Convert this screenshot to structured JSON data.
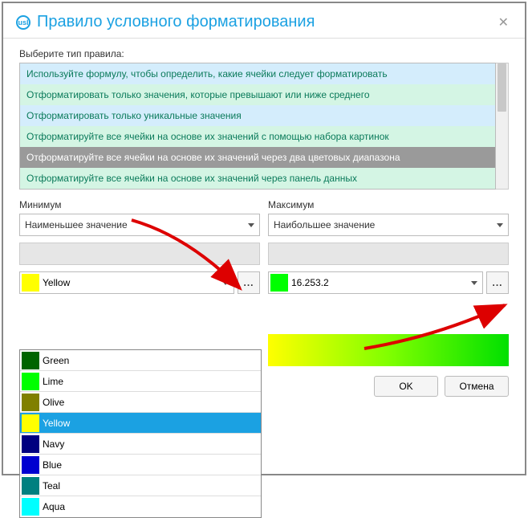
{
  "header": {
    "title": "Правило условного форматирования",
    "icon_text": "usl"
  },
  "rule_label": "Выберите тип правила:",
  "rules": [
    "Используйте формулу, чтобы определить, какие ячейки следует форматировать",
    "Отформатировать только значения, которые превышают или ниже среднего",
    "Отформатировать только уникальные значения",
    "Отформатируйте все ячейки на основе их значений с помощью набора картинок",
    "Отформатируйте все ячейки на основе их значений через два цветовых диапазона",
    "Отформатируйте все ячейки на основе их значений через панель данных"
  ],
  "min": {
    "label": "Минимум",
    "value_type": "Наименьшее значение",
    "color_label": "Yellow"
  },
  "max": {
    "label": "Максимум",
    "value_type": "Наибольшее значение",
    "color_label": "16.253.2"
  },
  "dots": "...",
  "color_options": [
    {
      "name": "Green"
    },
    {
      "name": "Lime"
    },
    {
      "name": "Olive"
    },
    {
      "name": "Yellow"
    },
    {
      "name": "Navy"
    },
    {
      "name": "Blue"
    },
    {
      "name": "Teal"
    },
    {
      "name": "Aqua"
    }
  ],
  "buttons": {
    "ok": "OK",
    "cancel": "Отмена"
  }
}
